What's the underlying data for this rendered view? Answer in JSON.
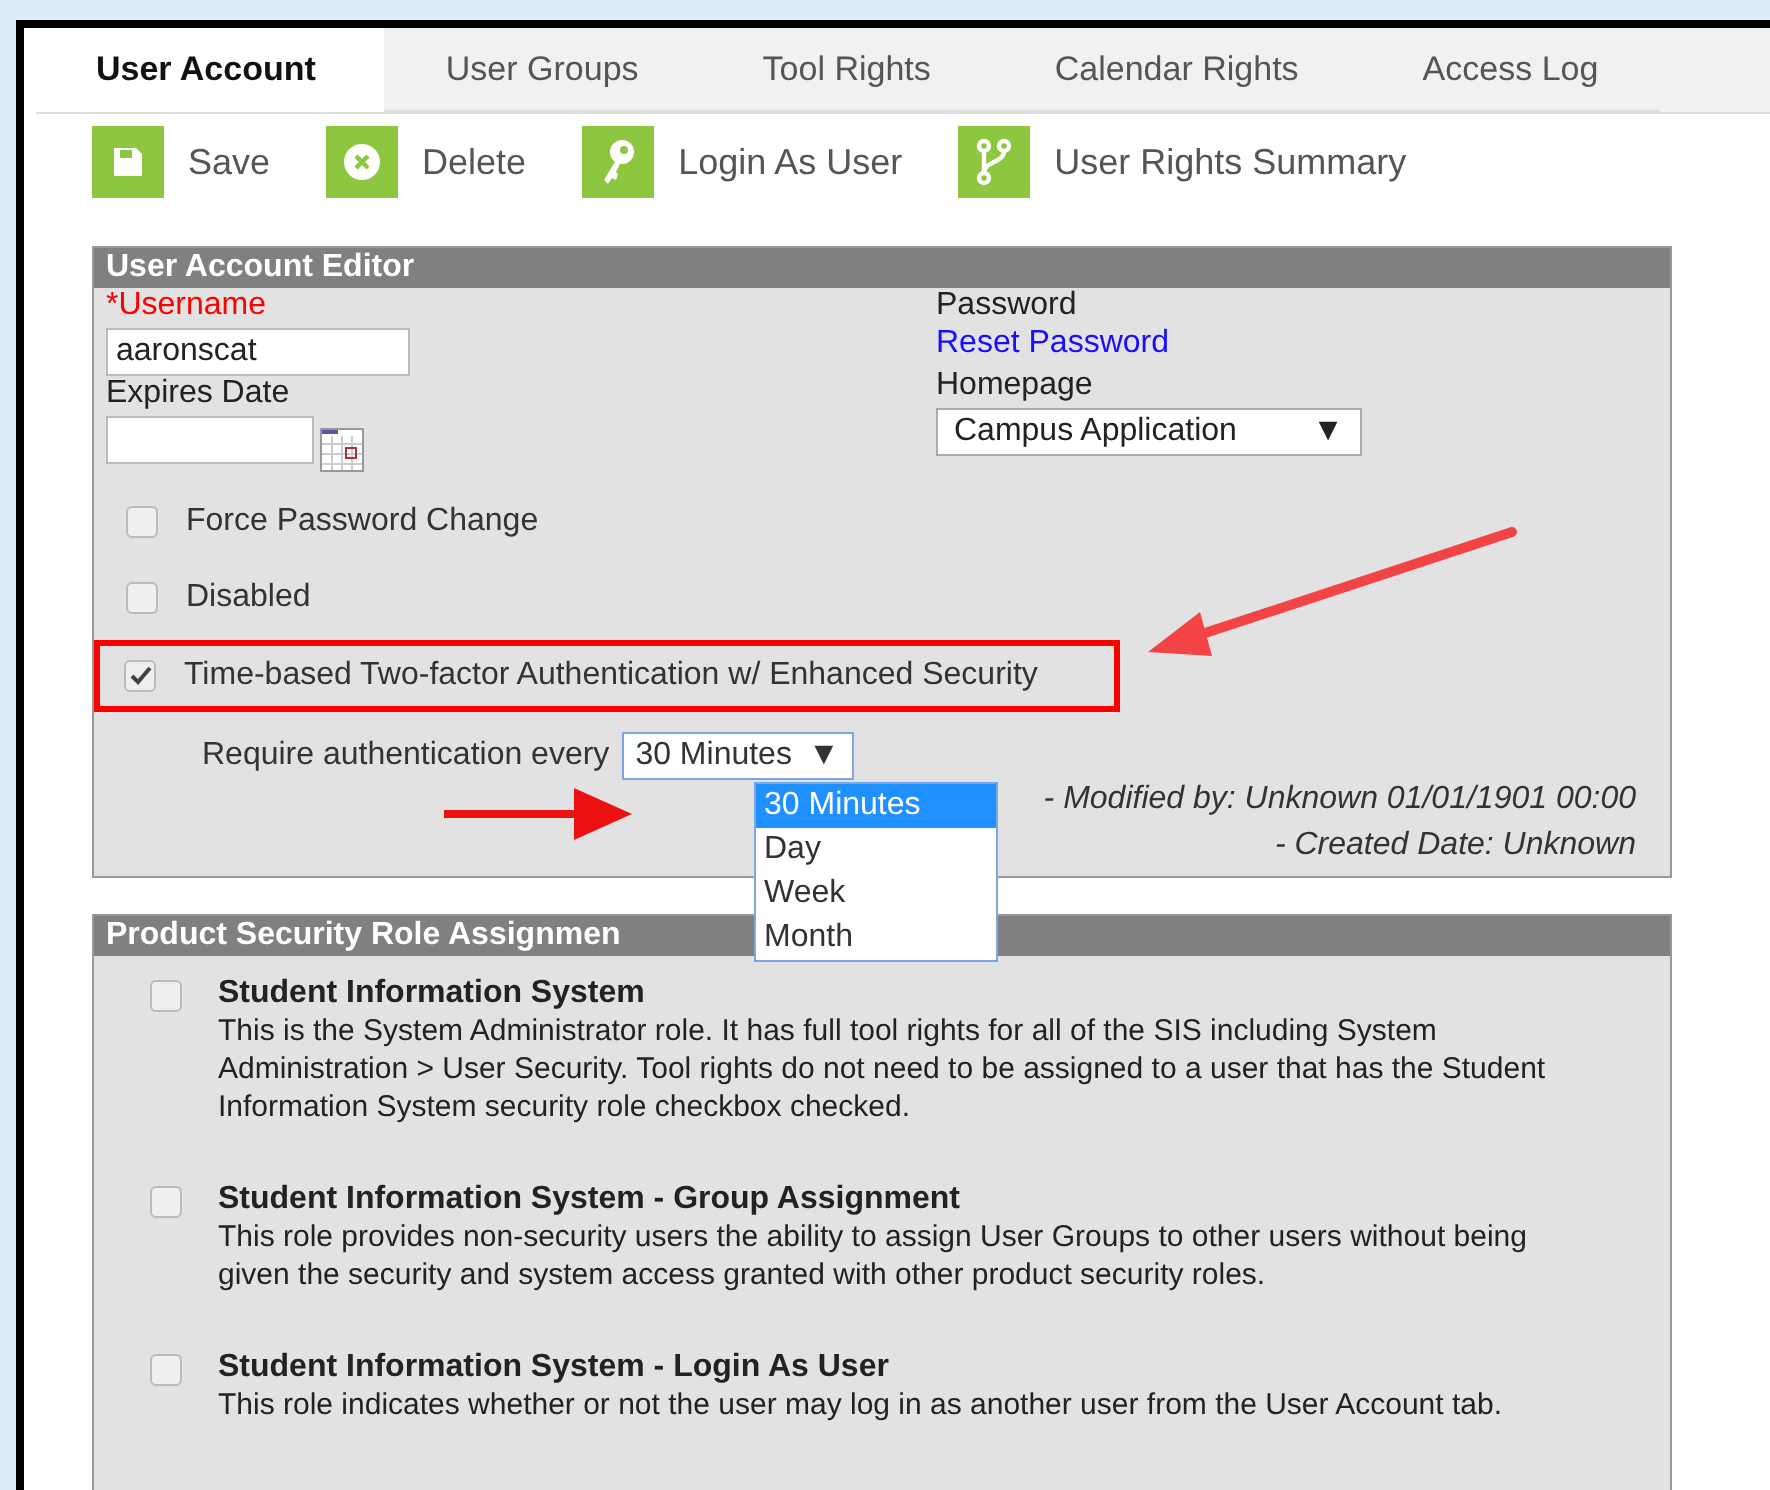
{
  "tabs": [
    {
      "label": "User Account",
      "selected": true
    },
    {
      "label": "User Groups",
      "selected": false
    },
    {
      "label": "Tool Rights",
      "selected": false
    },
    {
      "label": "Calendar Rights",
      "selected": false
    },
    {
      "label": "Access Log",
      "selected": false
    }
  ],
  "toolbar": [
    {
      "kind": "save",
      "label": "Save"
    },
    {
      "kind": "delete",
      "label": "Delete"
    },
    {
      "kind": "key",
      "label": "Login As User"
    },
    {
      "kind": "branch",
      "label": "User Rights Summary"
    }
  ],
  "editor": {
    "title": "User Account Editor",
    "username": {
      "label": "*Username",
      "value": "aaronscat"
    },
    "password": {
      "label": "Password",
      "link": "Reset Password"
    },
    "expires": {
      "label": "Expires Date"
    },
    "homepage": {
      "label": "Homepage",
      "value": "Campus Application",
      "caret": "▼"
    },
    "options": [
      {
        "label": "Force Password Change",
        "checked": false,
        "highlighted": false
      },
      {
        "label": "Disabled",
        "checked": false,
        "highlighted": false
      },
      {
        "label": "Time-based Two-factor Authentication w/ Enhanced Security",
        "checked": true,
        "highlighted": true
      }
    ],
    "auth": {
      "label": "Require authentication every",
      "value": "30 Minutes",
      "caret": "▼",
      "expanded": true,
      "options": [
        {
          "label": "30 Minutes",
          "selected": true
        },
        {
          "label": "Day",
          "selected": false
        },
        {
          "label": "Week",
          "selected": false
        },
        {
          "label": "Month",
          "selected": false
        }
      ]
    },
    "modified": "- Modified by: Unknown 01/01/1901 00:00",
    "created": "- Created Date: Unknown"
  },
  "roles": {
    "title": "Product Security Role Assignmen",
    "items": [
      {
        "name": "Student Information System",
        "description": "This is the System Administrator role. It has full tool rights for all of the SIS including System Administration > User Security. Tool rights do not need to be assigned to a user that has the Student Information System security role checkbox checked.",
        "checked": false
      },
      {
        "name": "Student Information System - Group Assignment",
        "description": "This role provides non-security users the ability to assign User Groups to other users without being given the security and system access granted with other product security roles.",
        "checked": false
      },
      {
        "name": "Student Information System - Login As User",
        "description": "This role indicates whether or not the user may log in as another user from the User Account tab.",
        "checked": false
      }
    ]
  }
}
